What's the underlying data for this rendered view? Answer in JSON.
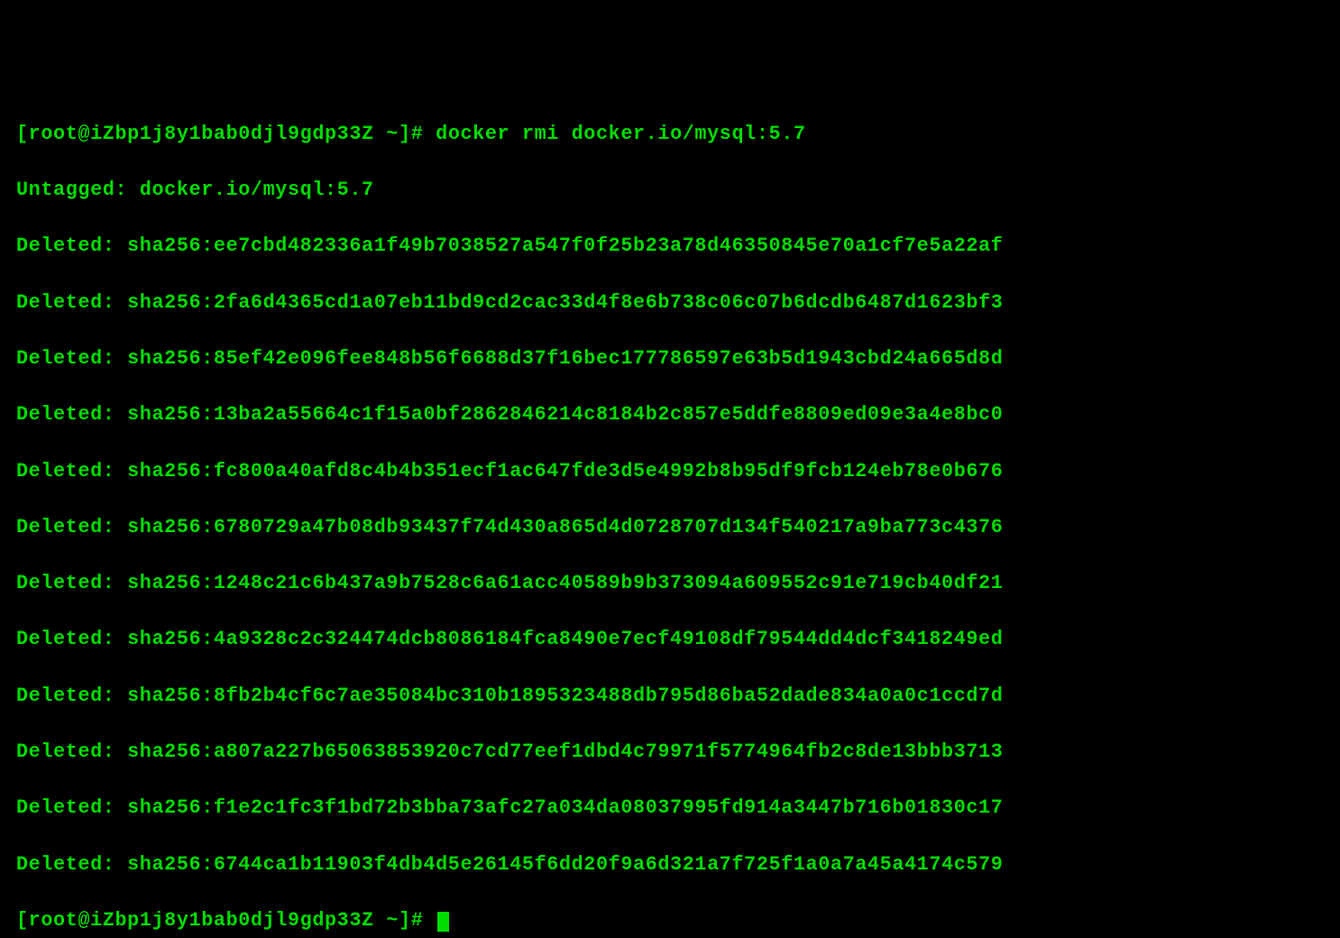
{
  "terminal": {
    "prompt": "[root@iZbp1j8y1bab0djl9gdp33Z ~]# ",
    "command": "docker rmi docker.io/mysql:5.7",
    "lines": [
      "Untagged: docker.io/mysql:5.7",
      "Deleted: sha256:ee7cbd482336a1f49b7038527a547f0f25b23a78d46350845e70a1cf7e5a22af",
      "Deleted: sha256:2fa6d4365cd1a07eb11bd9cd2cac33d4f8e6b738c06c07b6dcdb6487d1623bf3",
      "Deleted: sha256:85ef42e096fee848b56f6688d37f16bec177786597e63b5d1943cbd24a665d8d",
      "Deleted: sha256:13ba2a55664c1f15a0bf2862846214c8184b2c857e5ddfe8809ed09e3a4e8bc0",
      "Deleted: sha256:fc800a40afd8c4b4b351ecf1ac647fde3d5e4992b8b95df9fcb124eb78e0b676",
      "Deleted: sha256:6780729a47b08db93437f74d430a865d4d0728707d134f540217a9ba773c4376",
      "Deleted: sha256:1248c21c6b437a9b7528c6a61acc40589b9b373094a609552c91e719cb40df21",
      "Deleted: sha256:4a9328c2c324474dcb8086184fca8490e7ecf49108df79544dd4dcf3418249ed",
      "Deleted: sha256:8fb2b4cf6c7ae35084bc310b1895323488db795d86ba52dade834a0a0c1ccd7d",
      "Deleted: sha256:a807a227b65063853920c7cd77eef1dbd4c79971f5774964fb2c8de13bbb3713",
      "Deleted: sha256:f1e2c1fc3f1bd72b3bba73afc27a034da08037995fd914a3447b716b01830c17",
      "Deleted: sha256:6744ca1b11903f4db4d5e26145f6dd20f9a6d321a7f725f1a0a7a45a4174c579"
    ],
    "prompt2": "[root@iZbp1j8y1bab0djl9gdp33Z ~]# "
  }
}
